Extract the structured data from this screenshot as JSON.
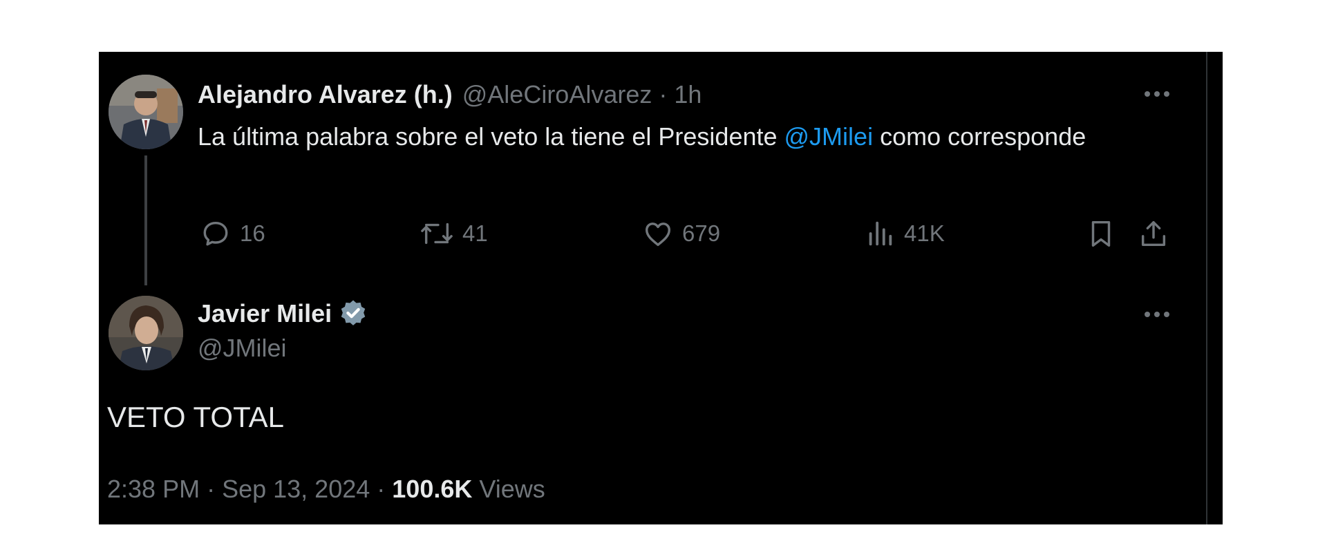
{
  "reply_tweet": {
    "author_name": "Alejandro Alvarez (h.)",
    "author_handle": "@AleCiroAlvarez",
    "separator": "·",
    "time": "1h",
    "text_before": "La última palabra sobre el veto la tiene el Presidente ",
    "mention": "@JMilei",
    "text_after": " como corresponde",
    "replies": "16",
    "reposts": "41",
    "likes": "679",
    "views": "41K",
    "icons": [
      "reply-icon",
      "repost-icon",
      "like-icon",
      "views-icon",
      "bookmark-icon",
      "share-icon",
      "more-icon"
    ]
  },
  "main_tweet": {
    "author_name": "Javier Milei",
    "author_handle": "@JMilei",
    "verified": true,
    "text": "VETO TOTAL",
    "time": "2:38 PM",
    "sep1": " · ",
    "date": "Sep 13, 2024",
    "sep2": " · ",
    "view_count": "100.6K",
    "views_label": " Views"
  },
  "colors": {
    "background": "#000000",
    "primary_text": "#e7e9ea",
    "secondary_text": "#71767b",
    "mention": "#1d9bf0",
    "verified_badge": "#829aab"
  }
}
